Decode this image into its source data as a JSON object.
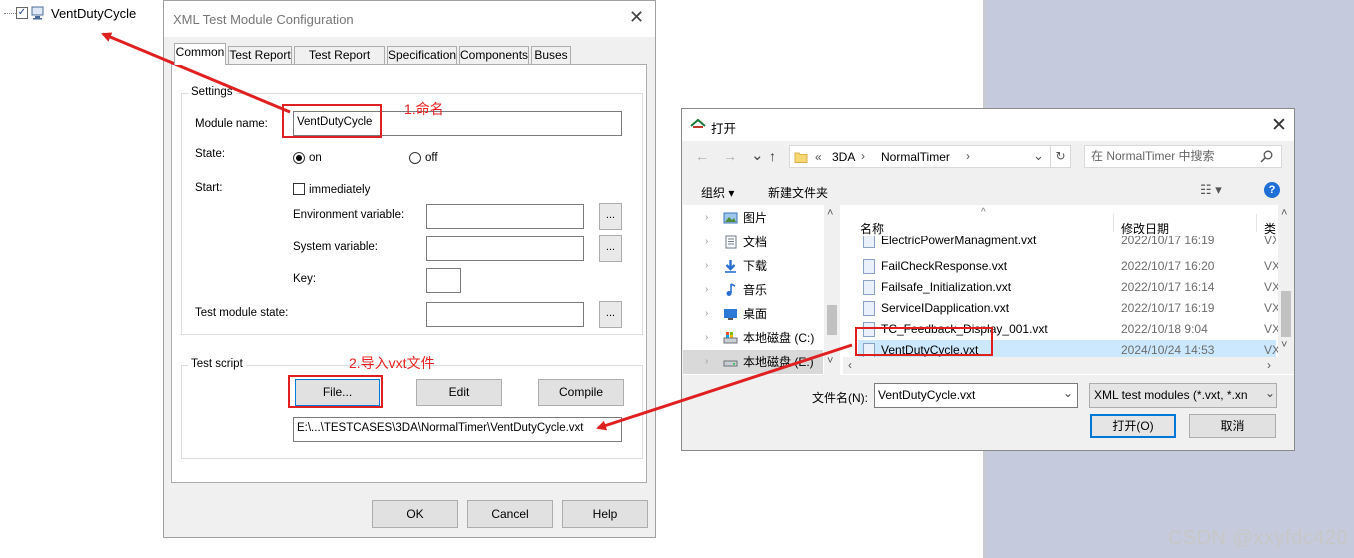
{
  "tree": {
    "item_label": "VentDutyCycle"
  },
  "xml_dialog": {
    "title": "XML Test Module Configuration",
    "close_glyph": "✕",
    "tabs": [
      "Common",
      "Test Report",
      "Test Report Filter",
      "Specification",
      "Components",
      "Buses"
    ],
    "settings": {
      "group_label": "Settings",
      "module_name_label": "Module name:",
      "module_name_value": "VentDutyCycle",
      "state_label": "State:",
      "state_on": "on",
      "state_off": "off",
      "start_label": "Start:",
      "immediately": "immediately",
      "env_var_label": "Environment variable:",
      "sys_var_label": "System variable:",
      "key_label": "Key:",
      "test_module_state_label": "Test module state:",
      "dots": "..."
    },
    "test_script": {
      "group_label": "Test script",
      "file_button": "File...",
      "edit_button": "Edit",
      "compile_button": "Compile",
      "path_value": "E:\\...\\TESTCASES\\3DA\\NormalTimer\\VentDutyCycle.vxt"
    },
    "footer": {
      "ok": "OK",
      "cancel": "Cancel",
      "help": "Help"
    }
  },
  "annotations": {
    "step1": "1.命名",
    "step2": "2.导入vxt文件",
    "color": "#e82020"
  },
  "open_dialog": {
    "title": "打开",
    "close_glyph": "✕",
    "nav": {
      "back": "←",
      "forward": "→",
      "up": "↑"
    },
    "breadcrumb": {
      "sep": "«",
      "folder1": "3DA",
      "arrow1": "›",
      "folder2": "NormalTimer",
      "arrow2": "›"
    },
    "search_placeholder": "在 NormalTimer 中搜索",
    "toolbar": {
      "organize": "组织 ▾",
      "new_folder": "新建文件夹",
      "help": "?"
    },
    "sidebar": [
      {
        "label": "图片",
        "icon": "pictures-icon"
      },
      {
        "label": "文档",
        "icon": "documents-icon"
      },
      {
        "label": "下载",
        "icon": "downloads-icon"
      },
      {
        "label": "音乐",
        "icon": "music-icon"
      },
      {
        "label": "桌面",
        "icon": "desktop-icon"
      },
      {
        "label": "本地磁盘 (C:)",
        "icon": "drive-c-icon"
      },
      {
        "label": "本地磁盘 (E:)",
        "icon": "drive-e-icon"
      }
    ],
    "columns": {
      "name": "名称",
      "date": "修改日期",
      "type": "类"
    },
    "files": [
      {
        "name": "ElectricPowerManagment.vxt",
        "date": "2022/10/17 16:19",
        "type": "VX"
      },
      {
        "name": "FailCheckResponse.vxt",
        "date": "2022/10/17 16:20",
        "type": "VX"
      },
      {
        "name": "Failsafe_Initialization.vxt",
        "date": "2022/10/17 16:14",
        "type": "VX"
      },
      {
        "name": "ServiceIDapplication.vxt",
        "date": "2022/10/17 16:19",
        "type": "VX"
      },
      {
        "name": "TC_Feedback_Display_001.vxt",
        "date": "2022/10/18 9:04",
        "type": "VX"
      },
      {
        "name": "VentDutyCycle.vxt",
        "date": "2024/10/24 14:53",
        "type": "VX"
      }
    ],
    "filename_label": "文件名(N):",
    "filename_value": "VentDutyCycle.vxt",
    "filter_value": "XML test modules (*.vxt, *.xn",
    "open_button": "打开(O)",
    "cancel_button": "取消"
  },
  "watermark": "CSDN @xxyfdc420"
}
